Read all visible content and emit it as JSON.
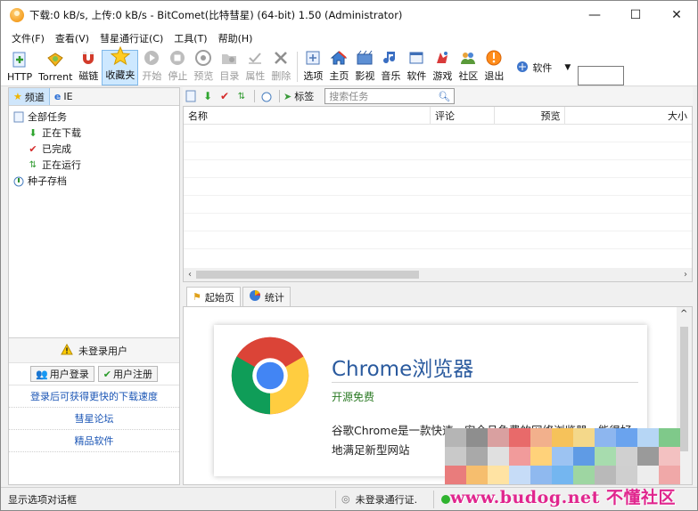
{
  "window": {
    "title": "下载:0 kB/s, 上传:0 kB/s - BitComet(比特彗星) (64-bit) 1.50 (Administrator)",
    "controls": [
      "—",
      "☐",
      "✕"
    ]
  },
  "menu": [
    "文件(F)",
    "查看(V)",
    "彗星通行证(C)",
    "工具(T)",
    "帮助(H)"
  ],
  "toolbar": {
    "buttons": [
      {
        "label": "HTTP",
        "icon": "http-add-icon",
        "enabled": true
      },
      {
        "label": "Torrent",
        "icon": "torrent-add-icon",
        "enabled": true
      },
      {
        "label": "磁链",
        "icon": "magnet-icon",
        "enabled": true
      },
      {
        "label": "收藏夹",
        "icon": "favorites-star-icon",
        "enabled": true,
        "active": true
      },
      {
        "label": "开始",
        "icon": "start-icon",
        "enabled": false
      },
      {
        "label": "停止",
        "icon": "stop-icon",
        "enabled": false
      },
      {
        "label": "预览",
        "icon": "preview-icon",
        "enabled": false
      },
      {
        "label": "目录",
        "icon": "folder-icon",
        "enabled": false
      },
      {
        "label": "属性",
        "icon": "properties-icon",
        "enabled": false
      },
      {
        "label": "删除",
        "icon": "delete-icon",
        "enabled": false
      },
      {
        "label": "选项",
        "icon": "options-icon",
        "enabled": true
      },
      {
        "label": "主页",
        "icon": "home-icon",
        "enabled": true
      },
      {
        "label": "影视",
        "icon": "video-icon",
        "enabled": true
      },
      {
        "label": "音乐",
        "icon": "music-icon",
        "enabled": true
      },
      {
        "label": "软件",
        "icon": "software-icon",
        "enabled": true
      },
      {
        "label": "游戏",
        "icon": "game-icon",
        "enabled": true
      },
      {
        "label": "社区",
        "icon": "community-icon",
        "enabled": true
      },
      {
        "label": "退出",
        "icon": "exit-icon",
        "enabled": true
      }
    ],
    "search_category": "软件"
  },
  "left_panel": {
    "tabs": [
      {
        "label": "频道",
        "icon": "star-icon"
      },
      {
        "label": "IE",
        "icon": "ie-icon"
      }
    ],
    "tree": [
      {
        "label": "全部任务",
        "icon": "all-tasks-icon",
        "indent": 0
      },
      {
        "label": "正在下载",
        "icon": "download-arrow-icon",
        "indent": 1
      },
      {
        "label": "已完成",
        "icon": "checkmark-icon",
        "indent": 1
      },
      {
        "label": "正在运行",
        "icon": "running-icon",
        "indent": 1
      },
      {
        "label": "种子存档",
        "icon": "torrent-archive-icon",
        "indent": 0
      }
    ],
    "login": {
      "header": "未登录用户",
      "login_button": "用户登录",
      "register_button": "用户注册",
      "links": [
        "登录后可获得更快的下载速度",
        "彗星论坛",
        "精品软件"
      ]
    }
  },
  "task_area": {
    "tag_label": "标签",
    "search_placeholder": "搜索任务",
    "columns": [
      "名称",
      "评论",
      "预览",
      "大小"
    ]
  },
  "detail": {
    "tabs": [
      "起始页",
      "统计"
    ],
    "card": {
      "title": "Chrome浏览器",
      "subtitle": "开源免费",
      "description": "谷歌Chrome是一款快速、安全且免费的网络浏览器，能很好地满足新型网站"
    }
  },
  "statusbar": {
    "hint": "显示选项对话框",
    "passport": "未登录通行证."
  },
  "watermark": {
    "text": "www.budog.net 不懂社区"
  },
  "colors": {
    "accent_blue": "#2a5a9e",
    "link_blue": "#1a55b5",
    "green": "#2b7a24",
    "watermark_pink": "#e0268e"
  }
}
